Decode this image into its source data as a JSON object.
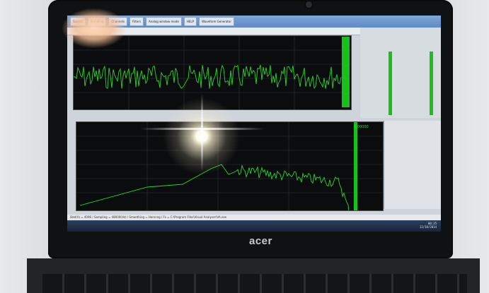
{
  "screen": {
    "tabs": [
      "Source",
      "Sampling",
      "Channels",
      "Filters",
      "Analog window mode",
      "HELP",
      "Waveform Generator"
    ],
    "status_line": "Stat(A) = 4096 / Sampling = 48000(Hz) / Smoothing = Hanning / Fs = C:\\Program Files\\Visual Analyser\\VA.exe",
    "tray_time": "00:35",
    "tray_date": "12/10/2014",
    "spectrum_readout": "0.00000"
  },
  "laptop": {
    "brand": "acer"
  },
  "colors": {
    "trace": "#25d829",
    "bar": "#18c01a",
    "plot_bg": "#0b0c0d"
  }
}
